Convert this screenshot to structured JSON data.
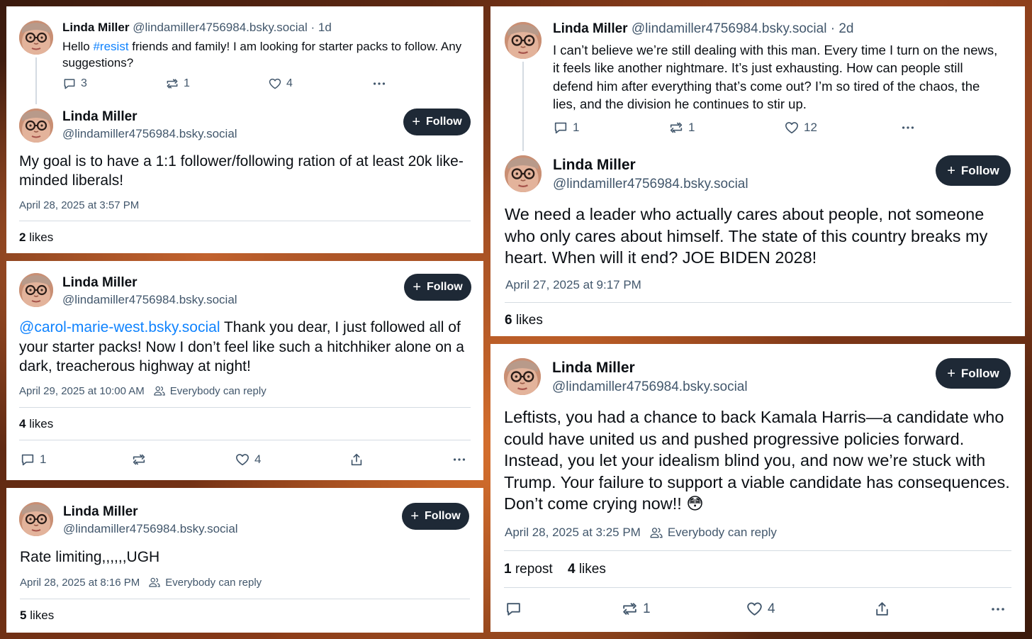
{
  "user": {
    "name": "Linda Miller",
    "handle": "@lindamiller4756984.bsky.social",
    "follow_label": "Follow"
  },
  "card_a": {
    "parent": {
      "age": "1d",
      "text_prefix": "Hello ",
      "hashtag": "#resist",
      "text_suffix": " friends and family! I am looking for starter packs to follow. Any suggestions?",
      "replies": "3",
      "reposts": "1",
      "likes": "4"
    },
    "post": {
      "text": "My goal is to have a 1:1 follower/following ration of at least 20k like-minded liberals!",
      "timestamp": "April 28, 2025 at 3:57 PM",
      "likes_count": "2",
      "likes_label": "likes"
    }
  },
  "card_b": {
    "mention": "@carol-marie-west.bsky.social",
    "text": " Thank you dear, I just followed all of your starter packs! Now I don’t feel like such a hitchhiker alone on a dark, treacherous highway at night!",
    "timestamp": "April 29, 2025 at 10:00 AM",
    "reply_setting": "Everybody can reply",
    "likes_count": "4",
    "likes_label": "likes",
    "replies": "1",
    "reposts": "",
    "likes": "4"
  },
  "card_c": {
    "text": "Rate limiting,,,,,,UGH",
    "timestamp": "April 28, 2025 at 8:16 PM",
    "reply_setting": "Everybody can reply",
    "likes_count": "5",
    "likes_label": "likes"
  },
  "card_d": {
    "parent": {
      "age": "2d",
      "text": "I can’t believe we’re still dealing with this man. Every time I turn on the news, it feels like another nightmare. It’s just exhausting. How can people still defend him after everything that’s come out? I’m so tired of the chaos, the lies, and the division he continues to stir up.",
      "replies": "1",
      "reposts": "1",
      "likes": "12"
    },
    "post": {
      "text": "We need a leader who actually cares about people, not someone who only cares about himself. The state of this country breaks my heart. When will it end? JOE BIDEN 2028!",
      "timestamp": "April 27, 2025 at 9:17 PM",
      "likes_count": "6",
      "likes_label": "likes"
    }
  },
  "card_e": {
    "text": "Leftists, you had a chance to back Kamala Harris—a candidate who could have united us and pushed progressive policies forward. Instead, you let your idealism blind you, and now we’re stuck with Trump. Your failure to support a viable candidate has consequences. Don’t come crying now!! 😳",
    "timestamp": "April 28, 2025 at 3:25 PM",
    "reply_setting": "Everybody can reply",
    "reposts_count": "1",
    "reposts_label": "repost",
    "likes_count": "4",
    "likes_label": "likes",
    "replies": "",
    "reposts": "1",
    "likes": "4"
  },
  "separator": " · ",
  "colors": {
    "link": "#1083fe",
    "muted": "#42576c",
    "follow_bg": "#1e2936",
    "divider": "#d4dbe2"
  },
  "icons": [
    "reply-icon",
    "repost-icon",
    "like-icon",
    "more-icon",
    "share-icon",
    "people-icon",
    "plus-icon",
    "avatar-face"
  ]
}
